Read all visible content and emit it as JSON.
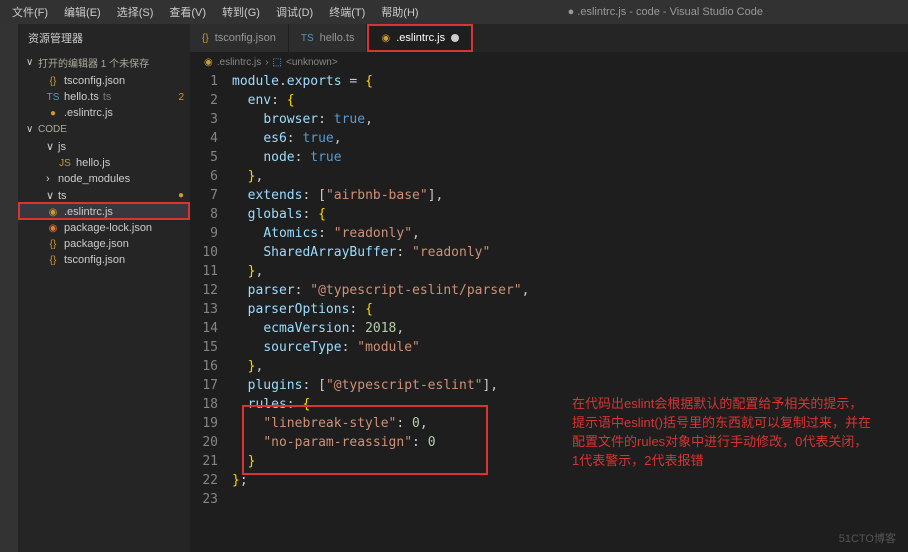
{
  "menu": {
    "file": "文件(F)",
    "edit": "编辑(E)",
    "select": "选择(S)",
    "view": "查看(V)",
    "goto": "转到(G)",
    "debug": "调试(D)",
    "terminal": "终端(T)",
    "help": "帮助(H)"
  },
  "window_title": "● .eslintrc.js - code - Visual Studio Code",
  "sidebar": {
    "title": "资源管理器",
    "open_editors_label": "打开的编辑器   1 个未保存",
    "open_editors": [
      {
        "name": "tsconfig.json",
        "icon": "{}",
        "cls": "yellow"
      },
      {
        "name": "hello.ts",
        "icon": "TS",
        "cls": "blue",
        "suffix": "ts",
        "badge": "2"
      },
      {
        "name": ".eslintrc.js",
        "icon": "●",
        "cls": "yellow",
        "highlight": true
      }
    ],
    "root": "CODE",
    "tree": [
      {
        "name": "js",
        "type": "folder",
        "chev": "∨",
        "indent": 1
      },
      {
        "name": "hello.js",
        "icon": "JS",
        "cls": "yellow",
        "indent": 2
      },
      {
        "name": "node_modules",
        "type": "folder",
        "chev": "›",
        "indent": 1
      },
      {
        "name": "ts",
        "type": "folder",
        "chev": "∨",
        "indent": 1,
        "badge": "●"
      },
      {
        "name": ".eslintrc.js",
        "icon": "◉",
        "cls": "yellow",
        "indent": 1,
        "active": true
      },
      {
        "name": "package-lock.json",
        "icon": "◉",
        "cls": "orange",
        "indent": 1
      },
      {
        "name": "package.json",
        "icon": "{}",
        "cls": "yellow",
        "indent": 1
      },
      {
        "name": "tsconfig.json",
        "icon": "{}",
        "cls": "yellow",
        "indent": 1
      }
    ]
  },
  "tabs": [
    {
      "name": "tsconfig.json",
      "icon": "{}",
      "cls": "yellow"
    },
    {
      "name": "hello.ts",
      "icon": "TS",
      "cls": "blue"
    },
    {
      "name": ".eslintrc.js",
      "icon": "◉",
      "cls": "yellow",
      "active": true,
      "modified": true,
      "boxed": true
    }
  ],
  "breadcrumb": {
    "file": ".eslintrc.js",
    "sep": "›",
    "sym": "<unknown>"
  },
  "code": {
    "lines": [
      [
        [
          "c-id",
          "module"
        ],
        [
          "c-punc",
          "."
        ],
        [
          "c-id",
          "exports"
        ],
        [
          "c-punc",
          " = "
        ],
        [
          "c-br",
          "{"
        ]
      ],
      [
        [
          "c-punc",
          "  "
        ],
        [
          "c-prop",
          "env"
        ],
        [
          "c-punc",
          ": "
        ],
        [
          "c-br",
          "{"
        ]
      ],
      [
        [
          "c-punc",
          "    "
        ],
        [
          "c-prop",
          "browser"
        ],
        [
          "c-punc",
          ": "
        ],
        [
          "c-key",
          "true"
        ],
        [
          "c-punc",
          ","
        ]
      ],
      [
        [
          "c-punc",
          "    "
        ],
        [
          "c-prop",
          "es6"
        ],
        [
          "c-punc",
          ": "
        ],
        [
          "c-key",
          "true"
        ],
        [
          "c-punc",
          ","
        ]
      ],
      [
        [
          "c-punc",
          "    "
        ],
        [
          "c-prop",
          "node"
        ],
        [
          "c-punc",
          ": "
        ],
        [
          "c-key",
          "true"
        ]
      ],
      [
        [
          "c-punc",
          "  "
        ],
        [
          "c-br",
          "}"
        ],
        [
          "c-punc",
          ","
        ]
      ],
      [
        [
          "c-punc",
          "  "
        ],
        [
          "c-prop",
          "extends"
        ],
        [
          "c-punc",
          ": ["
        ],
        [
          "c-str",
          "\"airbnb-base\""
        ],
        [
          "c-punc",
          "],"
        ]
      ],
      [
        [
          "c-punc",
          "  "
        ],
        [
          "c-prop",
          "globals"
        ],
        [
          "c-punc",
          ": "
        ],
        [
          "c-br",
          "{"
        ]
      ],
      [
        [
          "c-punc",
          "    "
        ],
        [
          "c-prop",
          "Atomics"
        ],
        [
          "c-punc",
          ": "
        ],
        [
          "c-str",
          "\"readonly\""
        ],
        [
          "c-punc",
          ","
        ]
      ],
      [
        [
          "c-punc",
          "    "
        ],
        [
          "c-prop",
          "SharedArrayBuffer"
        ],
        [
          "c-punc",
          ": "
        ],
        [
          "c-str",
          "\"readonly\""
        ]
      ],
      [
        [
          "c-punc",
          "  "
        ],
        [
          "c-br",
          "}"
        ],
        [
          "c-punc",
          ","
        ]
      ],
      [
        [
          "c-punc",
          "  "
        ],
        [
          "c-prop",
          "parser"
        ],
        [
          "c-punc",
          ": "
        ],
        [
          "c-str",
          "\"@typescript-eslint/parser\""
        ],
        [
          "c-punc",
          ","
        ]
      ],
      [
        [
          "c-punc",
          "  "
        ],
        [
          "c-prop",
          "parserOptions"
        ],
        [
          "c-punc",
          ": "
        ],
        [
          "c-br",
          "{"
        ]
      ],
      [
        [
          "c-punc",
          "    "
        ],
        [
          "c-prop",
          "ecmaVersion"
        ],
        [
          "c-punc",
          ": "
        ],
        [
          "c-num",
          "2018"
        ],
        [
          "c-punc",
          ","
        ]
      ],
      [
        [
          "c-punc",
          "    "
        ],
        [
          "c-prop",
          "sourceType"
        ],
        [
          "c-punc",
          ": "
        ],
        [
          "c-str",
          "\"module\""
        ]
      ],
      [
        [
          "c-punc",
          "  "
        ],
        [
          "c-br",
          "}"
        ],
        [
          "c-punc",
          ","
        ]
      ],
      [
        [
          "c-punc",
          "  "
        ],
        [
          "c-prop",
          "plugins"
        ],
        [
          "c-punc",
          ": ["
        ],
        [
          "c-str",
          "\"@typescript-eslint\""
        ],
        [
          "c-punc",
          "],"
        ]
      ],
      [
        [
          "c-punc",
          "  "
        ],
        [
          "c-prop",
          "rules"
        ],
        [
          "c-punc",
          ": "
        ],
        [
          "c-br",
          "{"
        ]
      ],
      [
        [
          "c-punc",
          "    "
        ],
        [
          "c-str",
          "\"linebreak-style\""
        ],
        [
          "c-punc",
          ": "
        ],
        [
          "c-num",
          "0"
        ],
        [
          "c-punc",
          ","
        ]
      ],
      [
        [
          "c-punc",
          "    "
        ],
        [
          "c-str",
          "\"no-param-reassign\""
        ],
        [
          "c-punc",
          ": "
        ],
        [
          "c-num",
          "0"
        ]
      ],
      [
        [
          "c-punc",
          "  "
        ],
        [
          "c-br",
          "}"
        ]
      ],
      [
        [
          "c-br",
          "}"
        ],
        [
          "c-punc",
          ";"
        ]
      ],
      [
        [
          "c-punc",
          ""
        ]
      ]
    ]
  },
  "annotation": "在代码出eslint会根据默认的配置给予相关的提示，提示语中eslint()括号里的东西就可以复制过来，并在配置文件的rules对象中进行手动修改，0代表关闭，1代表警示，2代表报错",
  "watermark": "51CTO博客"
}
